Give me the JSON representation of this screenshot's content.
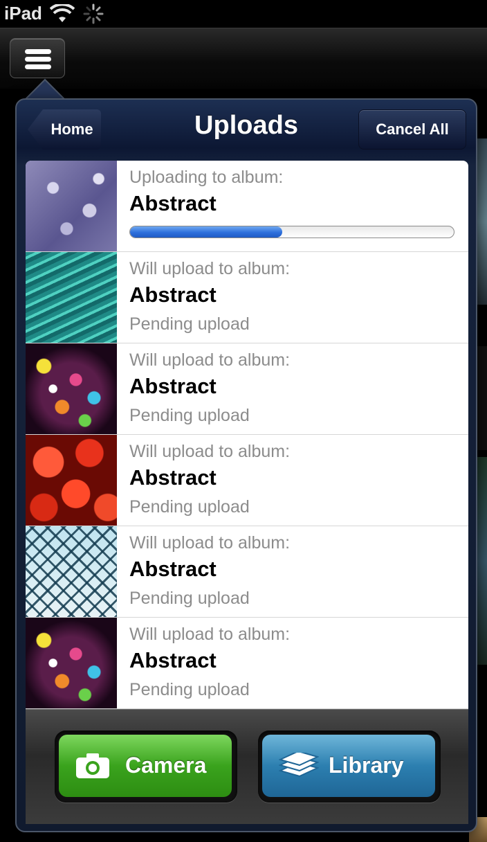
{
  "status_bar": {
    "carrier": "iPad"
  },
  "nav": {
    "back_label": "Home",
    "title": "Uploads",
    "cancel_label": "Cancel All"
  },
  "uploads": [
    {
      "caption": "Uploading to album:",
      "album": "Abstract",
      "progress": 0.47,
      "thumbnail": "water-droplets"
    },
    {
      "caption": "Will upload to album:",
      "album": "Abstract",
      "status": "Pending upload",
      "thumbnail": "teal-feathers"
    },
    {
      "caption": "Will upload to album:",
      "album": "Abstract",
      "status": "Pending upload",
      "thumbnail": "bokeh-lights"
    },
    {
      "caption": "Will upload to album:",
      "album": "Abstract",
      "status": "Pending upload",
      "thumbnail": "red-bokeh"
    },
    {
      "caption": "Will upload to album:",
      "album": "Abstract",
      "status": "Pending upload",
      "thumbnail": "wire-mesh"
    },
    {
      "caption": "Will upload to album:",
      "album": "Abstract",
      "status": "Pending upload",
      "thumbnail": "bokeh-lights"
    }
  ],
  "toolbar": {
    "camera_label": "Camera",
    "library_label": "Library"
  },
  "colors": {
    "progress": "#2d6fdc",
    "camera_button": "#3aa31d",
    "library_button": "#2c7fb0"
  }
}
